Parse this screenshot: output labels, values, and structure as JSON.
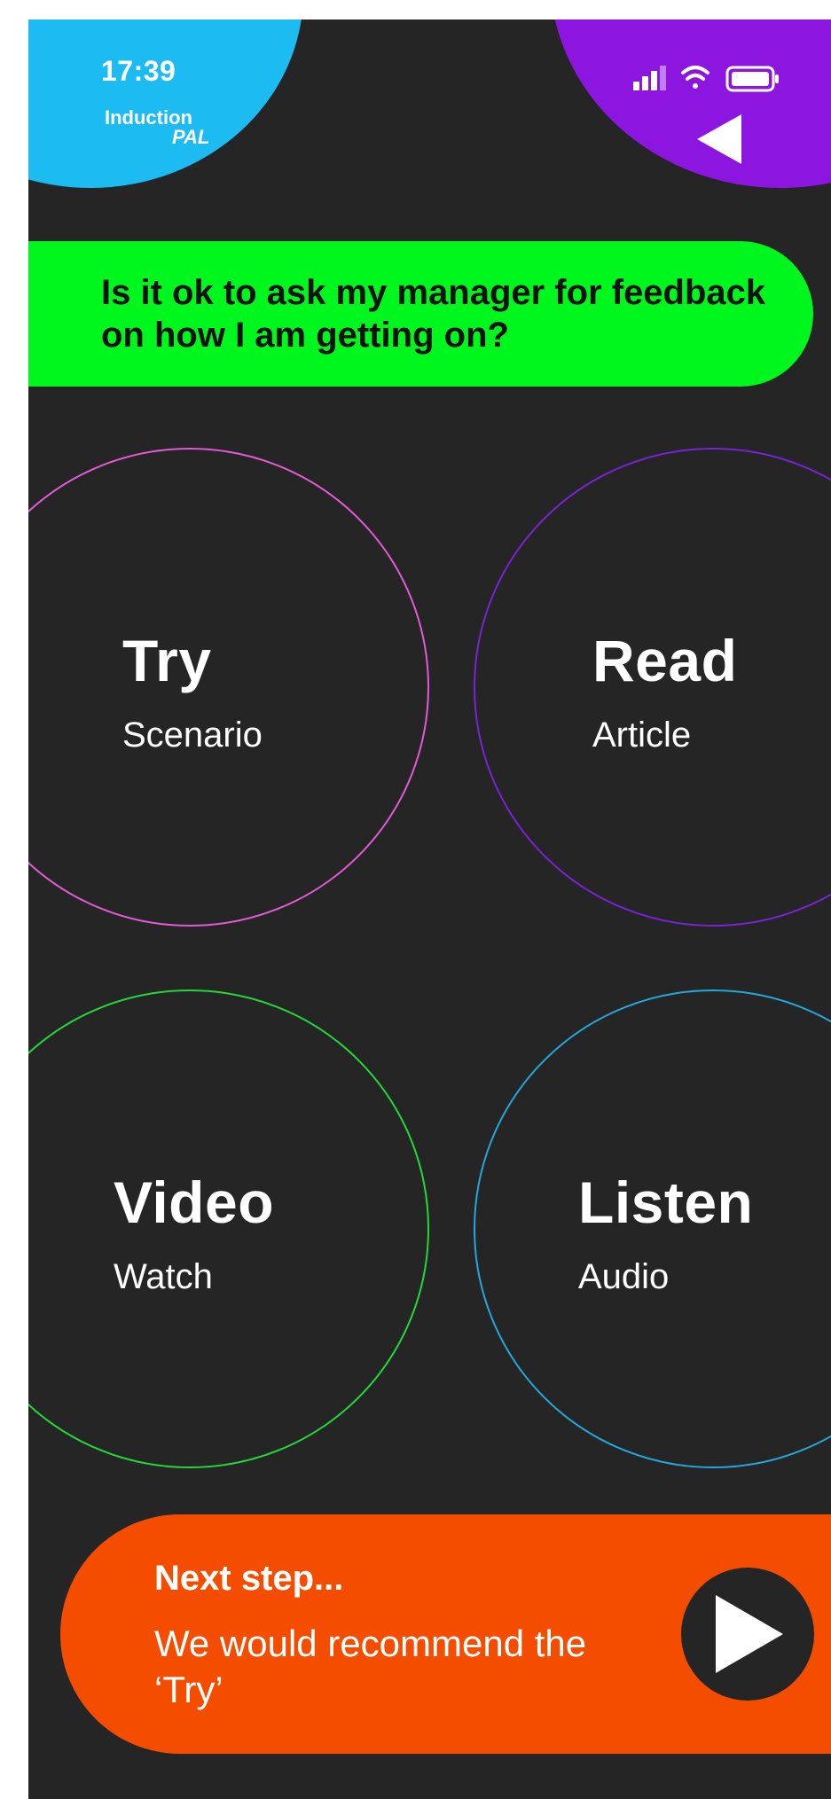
{
  "status_bar": {
    "time": "17:39"
  },
  "logo": {
    "line1": "Induction",
    "line2": "PAL"
  },
  "icons": {
    "signal": "signal-icon",
    "wifi": "wifi-icon",
    "battery": "battery-icon",
    "back": "back-triangle-icon",
    "play": "play-icon"
  },
  "question": "Is it ok to ask my manager for feedback on how I am getting on?",
  "options": [
    {
      "title": "Try",
      "subtitle": "Scenario",
      "color": "#e35ad6"
    },
    {
      "title": "Read",
      "subtitle": "Article",
      "color": "#7b22d6"
    },
    {
      "title": "Video",
      "subtitle": "Watch",
      "color": "#22d93a"
    },
    {
      "title": "Listen",
      "subtitle": "Audio",
      "color": "#22a8dc"
    }
  ],
  "next_step": {
    "title": "Next step...",
    "body": "We would recommend the ‘Try’"
  },
  "colors": {
    "background": "#252525",
    "blob_left": "#1cbcf3",
    "blob_right": "#8c15e0",
    "question_bg": "#00f71d",
    "next_bg": "#f44d00"
  }
}
